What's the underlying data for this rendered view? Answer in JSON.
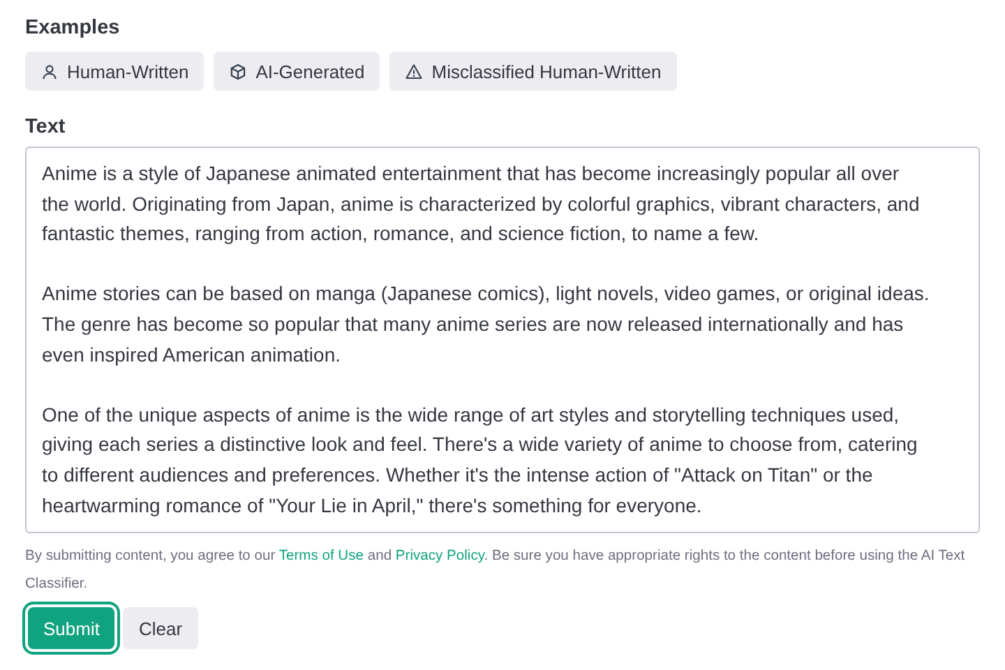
{
  "examples": {
    "heading": "Examples",
    "chips": [
      {
        "label": "Human-Written",
        "kind": "person"
      },
      {
        "label": "AI-Generated",
        "kind": "cube"
      },
      {
        "label": "Misclassified Human-Written",
        "kind": "warning"
      }
    ]
  },
  "text": {
    "heading": "Text",
    "value": [
      "Anime is a style of Japanese animated entertainment that has become increasingly popular all over the world. Originating from Japan, anime is characterized by colorful graphics, vibrant characters, and fantastic themes, ranging from action, romance, and science fiction, to name a few.",
      "Anime stories can be based on manga (Japanese comics), light novels, video games, or original ideas. The genre has become so popular that many anime series are now released internationally and has even inspired American animation.",
      "One of the unique aspects of anime is the wide range of art styles and storytelling techniques used, giving each series a distinctive look and feel. There's a wide variety of anime to choose from, catering to different audiences and preferences. Whether it's the intense action of \"Attack on Titan\" or the heartwarming romance of \"Your Lie in April,\" there's something for everyone."
    ]
  },
  "disclaimer": {
    "before": "By submitting content, you agree to our ",
    "link_1": "Terms of Use",
    "middle": " and ",
    "link_2": "Privacy Policy",
    "after": ". Be sure you have appropriate rights to the content before using the AI Text Classifier."
  },
  "buttons": [
    {
      "label": "Submit",
      "kind": "primary"
    },
    {
      "label": "Clear",
      "kind": "secondary"
    }
  ]
}
